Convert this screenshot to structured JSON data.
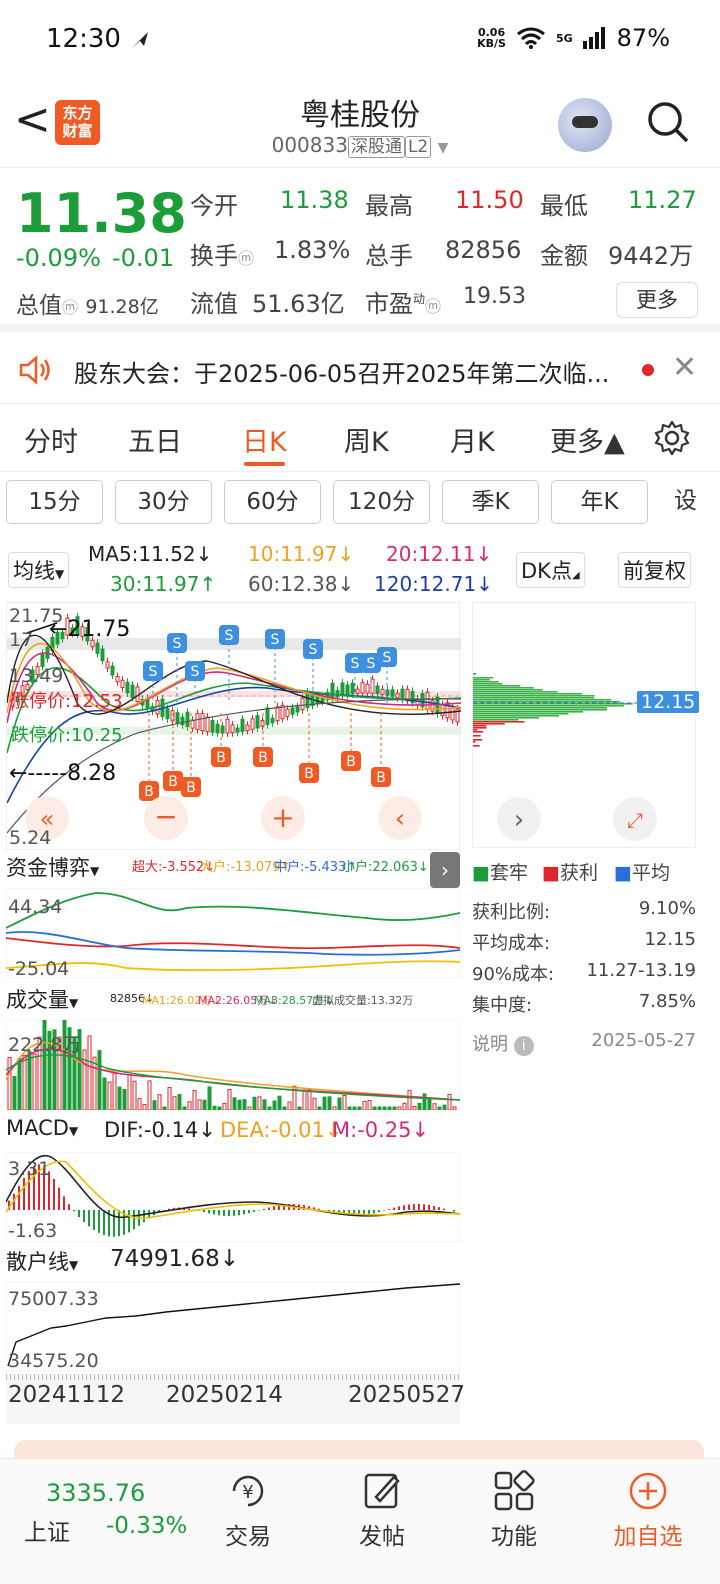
{
  "status_bar": {
    "time": "12:30",
    "net_speed": "0.06",
    "net_unit": "KB/S",
    "signal": "5G",
    "battery": "87%"
  },
  "header": {
    "back": "<",
    "logo_line1": "东方",
    "logo_line2": "财富",
    "title": "粤桂股份",
    "code": "000833",
    "tag1": "深股通",
    "tag2": "L2"
  },
  "quote": {
    "price": "11.38",
    "change_pct": "-0.09%",
    "change": "-0.01",
    "open_label": "今开",
    "open": "11.38",
    "high_label": "最高",
    "high": "11.50",
    "low_label": "最低",
    "low": "11.27",
    "turnover_label": "换手",
    "turnover": "1.83%",
    "volume_label": "总手",
    "volume": "82856",
    "amount_label": "金额",
    "amount": "9442万",
    "mcap_label": "总值",
    "mcap": "91.28亿",
    "float_label": "流值",
    "float": "51.63亿",
    "pe_label": "市盈",
    "pe_sup": "动",
    "pe": "19.53",
    "more": "更多"
  },
  "notice": {
    "text": "股东大会：于2025-06-05召开2025年第二次临..."
  },
  "period_tabs": [
    "分时",
    "五日",
    "日K",
    "周K",
    "月K",
    "更多▲"
  ],
  "active_period": "日K",
  "minute_buttons": [
    "15分",
    "30分",
    "60分",
    "120分",
    "季K",
    "年K",
    "设"
  ],
  "ma": {
    "dropdown": "均线",
    "ma5": "MA5:11.52↓",
    "ma10": "10:11.97↓",
    "ma20": "20:12.11↓",
    "ma30": "30:11.97↑",
    "ma60": "60:12.38↓",
    "ma120": "120:12.71↓",
    "dk": "DK点",
    "fq": "前复权",
    "colors": {
      "ma5": "#222222",
      "ma10": "#f0a020",
      "ma20": "#d6287a",
      "ma30": "#1b9d3a",
      "ma60": "#555555",
      "ma120": "#1a3fa8"
    }
  },
  "kline": {
    "high_label": "21.75",
    "high_tag": "21.75",
    "low_tag": "8.28",
    "y_top": "21.75",
    "y_17": "17",
    "y_mid": "13.49",
    "y_bottom": "5.24",
    "limit_up": "涨停价:12.53",
    "limit_down": "跌停价:10.25"
  },
  "chip": {
    "price_tag": "12.15",
    "legend_trapped": "套牢",
    "legend_profit": "获利",
    "legend_avg": "平均",
    "profit_ratio_label": "获利比例:",
    "profit_ratio": "9.10%",
    "avg_cost_label": "平均成本:",
    "avg_cost": "12.15",
    "cost90_label": "90%成本:",
    "cost90": "11.27-13.19",
    "concentration_label": "集中度:",
    "concentration": "7.85%",
    "note_label": "说明",
    "date": "2025-05-27"
  },
  "fund": {
    "dropdown": "资金博弈",
    "super": "超大:-3.552↓",
    "large": "大户:-13.079↑",
    "mid": "中户:-5.433↑",
    "small": "小户:22.063↓",
    "y_top": "44.34",
    "y_bottom": "-25.04"
  },
  "volume": {
    "dropdown": "成交量",
    "vol": "82856↓",
    "ma1": "MA1:26.02万↓",
    "ma2": "MA2:26.05万↓",
    "ma3": "MA3:28.57万↓",
    "virtual": "虚拟成交量:13.32万",
    "y_top": "222.8万"
  },
  "macd": {
    "dropdown": "MACD",
    "dif": "DIF:-0.14↓",
    "dea": "DEA:-0.01↓",
    "m": "M:-0.25↓",
    "y_top": "3.31",
    "y_bottom": "-1.63"
  },
  "retail": {
    "dropdown": "散户线",
    "value": "74991.68↓",
    "y_top": "75007.33",
    "y_bottom": "34575.20"
  },
  "dates": [
    "20241112",
    "20250214",
    "20250527"
  ],
  "bottom": {
    "index_value": "3335.76",
    "index_name": "上证",
    "index_change": "-0.33%",
    "nav": [
      "交易",
      "发帖",
      "功能",
      "加自选"
    ]
  }
}
